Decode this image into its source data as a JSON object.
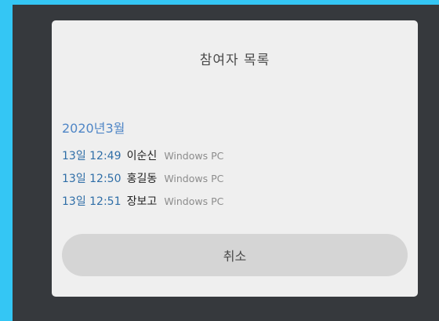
{
  "dialog": {
    "title": "참여자 목록",
    "month_label": "2020년3월",
    "participants": [
      {
        "time": "13일 12:49",
        "name": "이순신",
        "device": "Windows PC"
      },
      {
        "time": "13일 12:50",
        "name": "홍길동",
        "device": "Windows PC"
      },
      {
        "time": "13일 12:51",
        "name": "장보고",
        "device": "Windows PC"
      }
    ],
    "cancel_label": "취소"
  },
  "colors": {
    "accent": "#34c6f4",
    "backdrop": "#36393d",
    "dialog_bg": "#efefef",
    "time_text": "#2f6ea7",
    "month_text": "#4f86c6",
    "button_bg": "#d5d5d5"
  }
}
